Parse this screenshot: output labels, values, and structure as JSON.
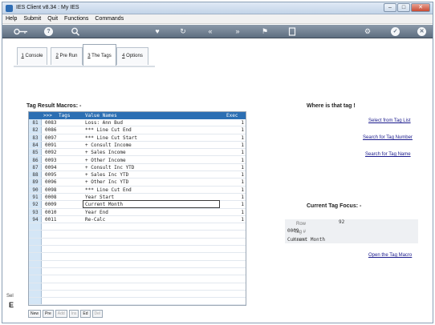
{
  "window": {
    "title": "IES Client v8.34 : My IES",
    "controls": {
      "minimize": "–",
      "maximize": "□",
      "close": "✕"
    }
  },
  "menubar": [
    "Help",
    "Submit",
    "Quit",
    "Functions",
    "Commands"
  ],
  "toolbar": {
    "icons": [
      "key-icon",
      "help-icon",
      "search-icon",
      "heart-icon",
      "refresh-icon",
      "rewind-icon",
      "fast-forward-icon",
      "flag-icon",
      "copy-icon",
      "stop-icon",
      "settings-icon",
      "check-icon",
      "close-icon"
    ]
  },
  "tabs": [
    {
      "key": "1",
      "label": "Console"
    },
    {
      "key": "2",
      "label": "Pre Run"
    },
    {
      "key": "3",
      "label": "The Tags",
      "active": true
    },
    {
      "key": "4",
      "label": "Options"
    }
  ],
  "grid": {
    "title": "Tag Result Macros: -",
    "headers": {
      "marker": ">>>",
      "tags": "Tags",
      "value_names": "Value Names",
      "exec": "Exec It"
    },
    "rows": [
      {
        "rn": "81",
        "tag": "0083",
        "name": "Loss: Ann Bud",
        "exec": "1"
      },
      {
        "rn": "82",
        "tag": "0086",
        "name": "*** Line Cut End",
        "exec": "1"
      },
      {
        "rn": "83",
        "tag": "0097",
        "name": "*** Line Cut Start",
        "exec": "1"
      },
      {
        "rn": "84",
        "tag": "0091",
        "name": "+ Consult Income",
        "exec": "1"
      },
      {
        "rn": "85",
        "tag": "0092",
        "name": "+ Sales Income",
        "exec": "1"
      },
      {
        "rn": "86",
        "tag": "0093",
        "name": "+ Other Income",
        "exec": "1"
      },
      {
        "rn": "87",
        "tag": "0094",
        "name": "+ Consult Inc YTD",
        "exec": "1"
      },
      {
        "rn": "88",
        "tag": "0095",
        "name": "+ Sales Inc YTD",
        "exec": "1"
      },
      {
        "rn": "89",
        "tag": "0096",
        "name": "+ Other Inc YTD",
        "exec": "1"
      },
      {
        "rn": "90",
        "tag": "0098",
        "name": "*** Line Cut End",
        "exec": "1"
      },
      {
        "rn": "91",
        "tag": "0008",
        "name": "Year Start",
        "exec": "1"
      },
      {
        "rn": "92",
        "tag": "0009",
        "name": "Current Month",
        "exec": "1",
        "focused": true
      },
      {
        "rn": "93",
        "tag": "0010",
        "name": "Year End",
        "exec": "1"
      },
      {
        "rn": "94",
        "tag": "0011",
        "name": "Re-Calc",
        "exec": "1"
      }
    ],
    "bottom_buttons": [
      {
        "label": "New",
        "enabled": true
      },
      {
        "label": "Pre",
        "enabled": true
      },
      {
        "label": "Add",
        "enabled": false
      },
      {
        "label": "Ins",
        "enabled": false
      },
      {
        "label": "Ed",
        "enabled": true
      },
      {
        "label": "Del",
        "enabled": false
      }
    ]
  },
  "side_fragment": {
    "small": "Sel",
    "large": "E"
  },
  "where_panel": {
    "title": "Where is that tag !",
    "links": [
      "Select from Tag List",
      "Search for Tag Number",
      "Search for Tag Name"
    ]
  },
  "focus_panel": {
    "title": "Current Tag Focus: -",
    "row_label": "Row",
    "row_value": "92",
    "tag_label": "Tag #",
    "tag_value": "0009",
    "name_label": "Name",
    "name_value": "Current Month",
    "link": "Open the Tag Macro"
  },
  "colors": {
    "grid_header": "#2c6fb3",
    "rownum_bg": "#d4e6f6",
    "toolbar": "#6e7d8e",
    "link": "#1a1a8c"
  }
}
